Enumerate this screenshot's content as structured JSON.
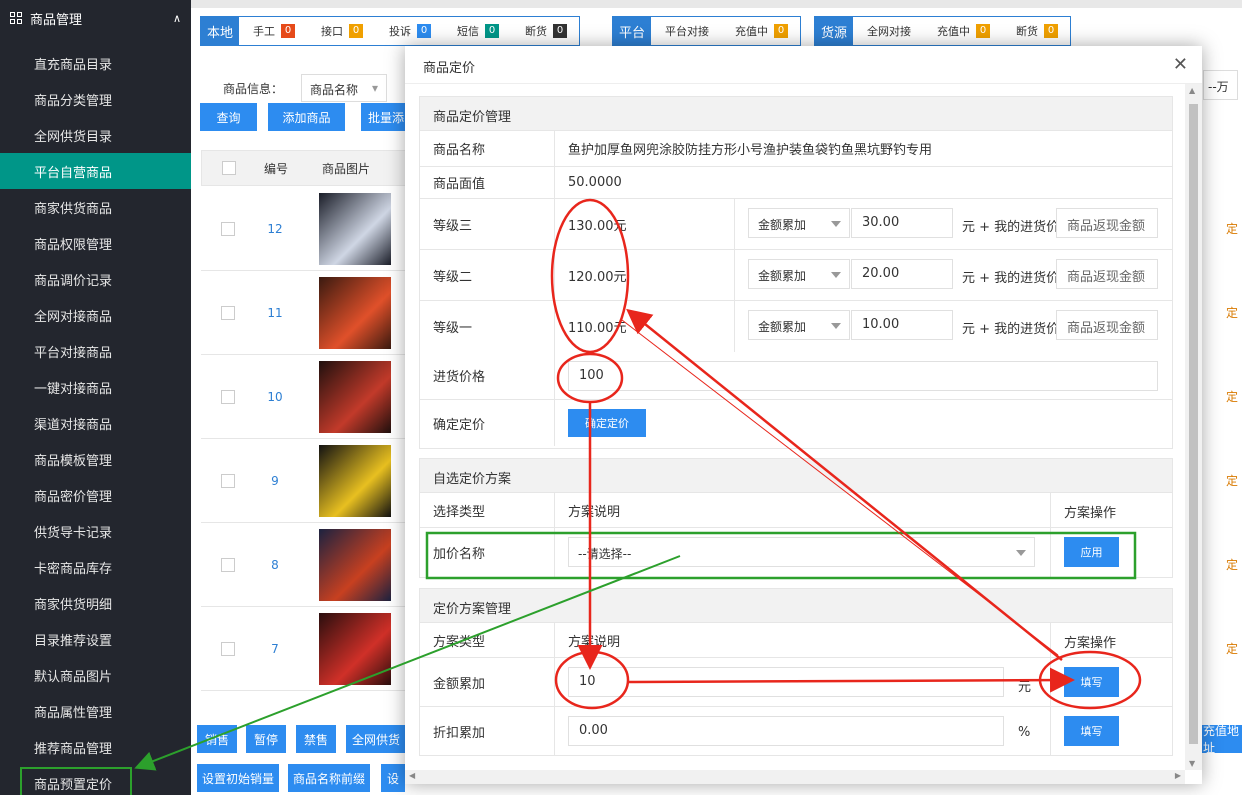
{
  "sidebar": {
    "title": "商品管理",
    "items": [
      "直充商品目录",
      "商品分类管理",
      "全网供货目录",
      "平台自营商品",
      "商家供货商品",
      "商品权限管理",
      "商品调价记录",
      "全网对接商品",
      "平台对接商品",
      "一键对接商品",
      "渠道对接商品",
      "商品模板管理",
      "商品密价管理",
      "供货导卡记录",
      "卡密商品库存",
      "商家供货明细",
      "目录推荐设置",
      "默认商品图片",
      "商品属性管理",
      "推荐商品管理",
      "商品预置定价"
    ]
  },
  "chips": {
    "local": {
      "tag": "本地",
      "items": [
        {
          "label": "手工",
          "count": "0",
          "color": "red"
        },
        {
          "label": "接口",
          "count": "0",
          "color": "orange"
        },
        {
          "label": "投诉",
          "count": "0",
          "color": "blue"
        },
        {
          "label": "短信",
          "count": "0",
          "color": "green"
        },
        {
          "label": "断货",
          "count": "0",
          "color": "dark"
        }
      ]
    },
    "platform": {
      "tag": "平台",
      "items": [
        {
          "label": "平台对接",
          "count": "",
          "color": ""
        },
        {
          "label": "充值中",
          "count": "0",
          "color": "orange"
        }
      ]
    },
    "source": {
      "tag": "货源",
      "items": [
        {
          "label": "全网对接",
          "count": "",
          "color": ""
        },
        {
          "label": "充值中",
          "count": "0",
          "color": "orange"
        },
        {
          "label": "断货",
          "count": "0",
          "color": "orange"
        }
      ]
    }
  },
  "filter": {
    "label": "商品信息：",
    "select": "商品名称",
    "right_select": "--万"
  },
  "buttons": {
    "query": "查询",
    "add": "添加商品",
    "batch": "批量添"
  },
  "table": {
    "headers": [
      "编号",
      "商品图片"
    ],
    "ids": [
      "12",
      "11",
      "10",
      "9",
      "8",
      "7"
    ],
    "edge_text": "定"
  },
  "bottom_buttons": {
    "row1": [
      "销售",
      "暂停",
      "禁售",
      "全网供货"
    ],
    "row2": [
      "设置初始销量",
      "商品名称前缀",
      "设"
    ],
    "right": "充值地址"
  },
  "modal": {
    "title": "商品定价",
    "pricing": {
      "header": "商品定价管理",
      "name_label": "商品名称",
      "name_value": "鱼护加厚鱼网兜涂胶防挂方形小号渔护装鱼袋钓鱼黑坑野钓专用",
      "face_label": "商品面值",
      "face_value": "50.0000",
      "levels": [
        {
          "label": "等级三",
          "price": "130.00元",
          "mode": "金额累加",
          "amount": "30.00",
          "suffix": "元 + 我的进货价",
          "rebate_placeholder": "商品返现金额"
        },
        {
          "label": "等级二",
          "price": "120.00元",
          "mode": "金额累加",
          "amount": "20.00",
          "suffix": "元 + 我的进货价",
          "rebate_placeholder": "商品返现金额"
        },
        {
          "label": "等级一",
          "price": "110.00元",
          "mode": "金额累加",
          "amount": "10.00",
          "suffix": "元 + 我的进货价",
          "rebate_placeholder": "商品返现金额"
        }
      ],
      "cost_label": "进货价格",
      "cost_value": "100",
      "confirm_label": "确定定价",
      "confirm_button": "确定定价"
    },
    "custom": {
      "header": "自选定价方案",
      "col1": "选择类型",
      "col2": "方案说明",
      "col3": "方案操作",
      "row_label": "加价名称",
      "select_value": "--请选择--",
      "apply_button": "应用"
    },
    "plans": {
      "header": "定价方案管理",
      "col1": "方案类型",
      "col2": "方案说明",
      "col3": "方案操作",
      "rows": [
        {
          "label": "金额累加",
          "value": "10",
          "unit": "元",
          "button": "填写"
        },
        {
          "label": "折扣累加",
          "value": "0.00",
          "unit": "%",
          "button": "填写"
        }
      ]
    }
  },
  "colors": {
    "sidebar_bg": "#23262e",
    "active": "#009688",
    "primary": "#2d8cf0",
    "annot_red": "#e8261c",
    "annot_green": "#2ca02c"
  }
}
